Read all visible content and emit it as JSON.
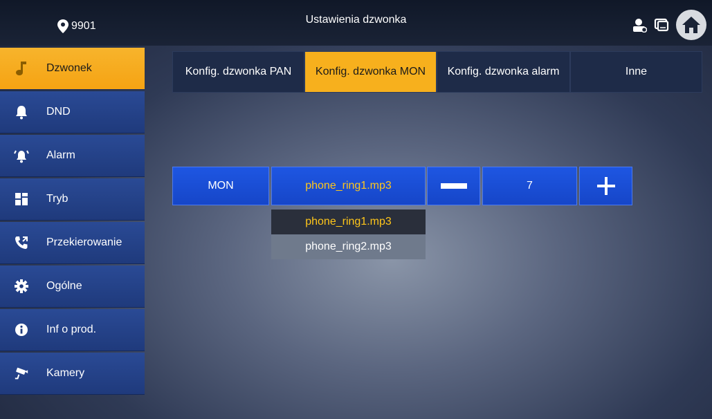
{
  "header": {
    "device_id": "9901",
    "title": "Ustawienia dzwonka"
  },
  "sidebar": {
    "items": [
      {
        "label": "Dzwonek",
        "icon": "music-note-icon",
        "active": true
      },
      {
        "label": "DND",
        "icon": "bell-icon"
      },
      {
        "label": "Alarm",
        "icon": "alarm-bell-icon"
      },
      {
        "label": "Tryb",
        "icon": "mode-grid-icon"
      },
      {
        "label": "Przekierowanie",
        "icon": "call-forward-icon"
      },
      {
        "label": "Ogólne",
        "icon": "gear-icon"
      },
      {
        "label": "Inf o prod.",
        "icon": "info-icon"
      },
      {
        "label": "Kamery",
        "icon": "camera-icon"
      }
    ]
  },
  "tabs": [
    {
      "label": "Konfig. dzwonka PAN"
    },
    {
      "label": "Konfig. dzwonka MON",
      "active": true
    },
    {
      "label": "Konfig. dzwonka alarm"
    },
    {
      "label": "Inne"
    }
  ],
  "ring_row": {
    "label": "MON",
    "selected_ringtone": "phone_ring1.mp3",
    "minus_symbol": "—",
    "volume": "7",
    "plus_symbol": "+"
  },
  "dropdown": {
    "options": [
      "phone_ring1.mp3",
      "phone_ring2.mp3"
    ]
  },
  "colors": {
    "accent": "#f7b01d",
    "control_blue": "#1a4fd6",
    "selected_text": "#ffc61a"
  }
}
